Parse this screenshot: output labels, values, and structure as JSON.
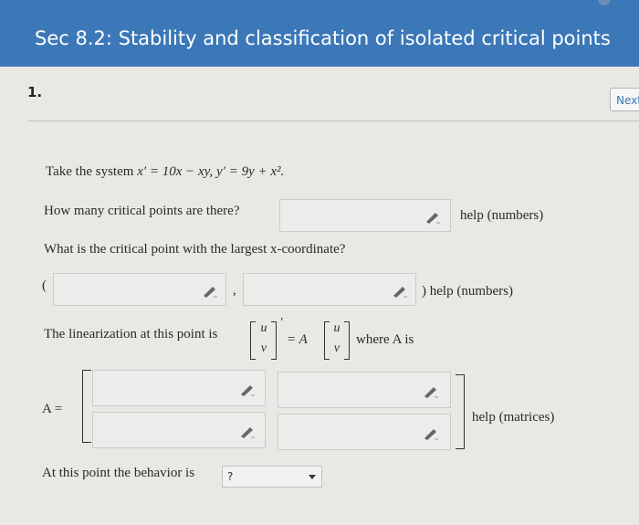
{
  "header": {
    "title": "Sec 8.2: Stability and classification of isolated critical points"
  },
  "question": {
    "number": "1.",
    "next_label": "Next"
  },
  "system": {
    "prefix": "Take the system",
    "equation": "x′ = 10x − xy,   y′ = 9y + x²."
  },
  "q1": {
    "prompt": "How many critical points are there?",
    "help": "help (numbers)"
  },
  "q2": {
    "prompt": "What is the critical point with the largest x-coordinate?",
    "open_paren": "(",
    "comma": ",",
    "close_help": ") help (numbers)"
  },
  "linearization": {
    "prefix": "The linearization at this point is",
    "u": "u",
    "v": "v",
    "prime": "′",
    "equals_A": "= A",
    "suffix": "where A is"
  },
  "matrix": {
    "label": "A =",
    "help": "help (matrices)"
  },
  "behavior": {
    "prompt": "At this point the behavior is",
    "selected": "?"
  },
  "icons": {
    "edit": "pencil-icon",
    "dropdown": "chevron-down-icon"
  }
}
